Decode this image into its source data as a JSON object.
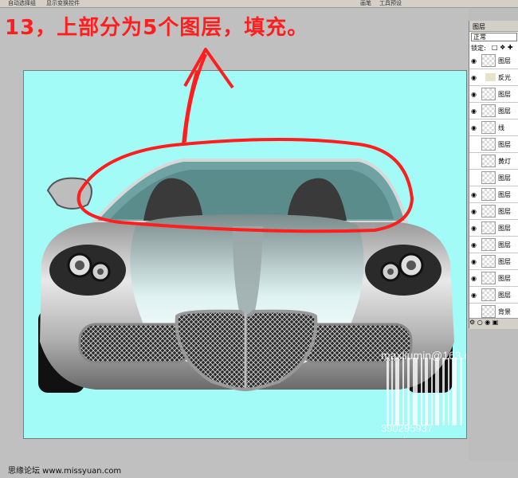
{
  "toolbar": {
    "auto_select": "自动选择组",
    "show_transform": "显示变换控件",
    "brush_tab": "画笔",
    "tool_presets_tab": "工具预设"
  },
  "instruction": "13，上部分为5个图层，填充。",
  "watermark": {
    "email": "maxliumin@163.com",
    "qq": "390295937  max.liu"
  },
  "layers_panel": {
    "tab": "图层",
    "blend_mode": "正常",
    "lock_label": "锁定:",
    "rows": [
      {
        "name": "图层",
        "visible": true
      },
      {
        "name": "反光",
        "visible": true,
        "folder": true
      },
      {
        "name": "图层",
        "visible": true
      },
      {
        "name": "图层",
        "visible": true
      },
      {
        "name": "线",
        "visible": true
      },
      {
        "name": "图层",
        "visible": false
      },
      {
        "name": "黄灯",
        "visible": false
      },
      {
        "name": "图层",
        "visible": false
      },
      {
        "name": "图层",
        "visible": true
      },
      {
        "name": "图层",
        "visible": true
      },
      {
        "name": "图层",
        "visible": true
      },
      {
        "name": "图层",
        "visible": true
      },
      {
        "name": "图层",
        "visible": true
      },
      {
        "name": "图层",
        "visible": true
      },
      {
        "name": "图层",
        "visible": true
      },
      {
        "name": "背景",
        "visible": false
      }
    ]
  },
  "footer": {
    "site": "思缘论坛  www.missyuan.com"
  },
  "colors": {
    "canvas_bg": "#a3fbf7",
    "annotation_red": "#ff1e1e",
    "workspace_gray": "#c0c0c0"
  }
}
